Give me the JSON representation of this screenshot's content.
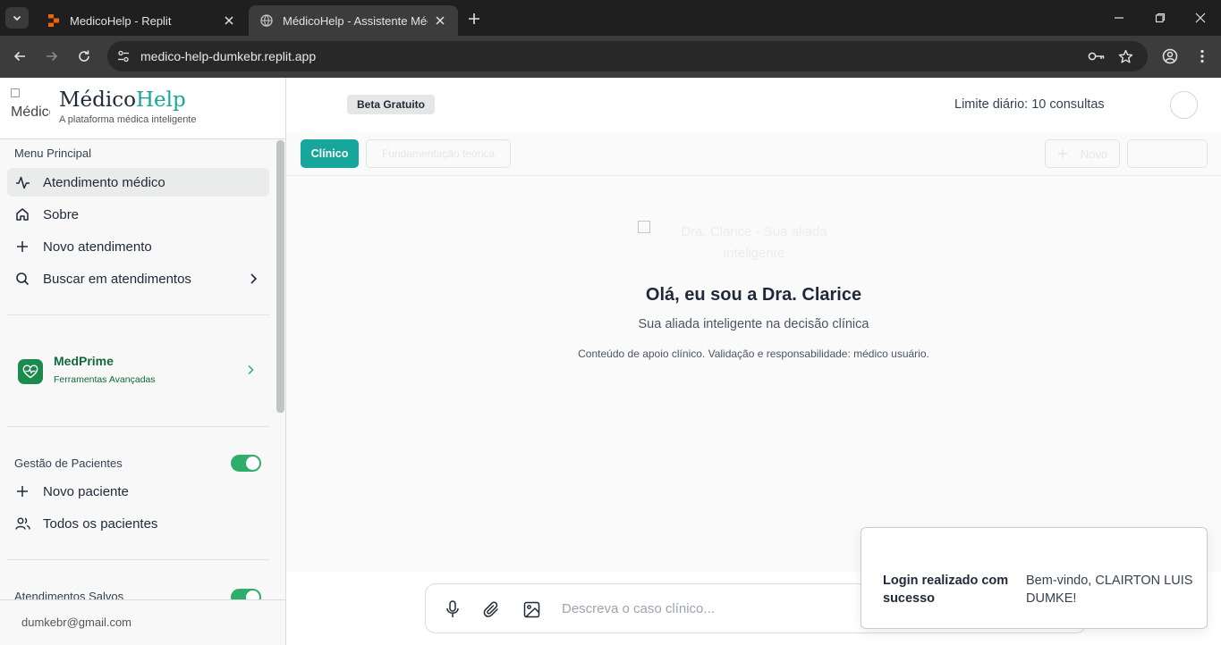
{
  "browser": {
    "tabs": [
      {
        "title": "MedicoHelp - Replit",
        "active": false
      },
      {
        "title": "MédicoHelp - Assistente Médico",
        "active": true
      }
    ],
    "url": "medico-help-dumkebr.replit.app"
  },
  "sidebar": {
    "logo_alt": "Médico",
    "brand_part1": "Médico",
    "brand_part2": "Help",
    "tagline": "A plataforma médica inteligente",
    "menu_label": "Menu Principal",
    "menu_items": [
      {
        "label": "Atendimento médico",
        "icon": "activity-icon",
        "active": true
      },
      {
        "label": "Sobre",
        "icon": "home-icon"
      },
      {
        "label": "Novo atendimento",
        "icon": "plus-icon"
      },
      {
        "label": "Buscar em atendimentos",
        "icon": "search-icon"
      }
    ],
    "medprime": {
      "title": "MedPrime",
      "subtitle": "Ferramentas Avançadas"
    },
    "patients": {
      "label": "Gestão de Pacientes",
      "toggle_on": true,
      "items": [
        {
          "label": "Novo paciente",
          "icon": "plus-icon"
        },
        {
          "label": "Todos os pacientes",
          "icon": "users-icon"
        }
      ]
    },
    "saved": {
      "label": "Atendimentos Salvos",
      "toggle_on": true
    },
    "user_email": "dumkebr@gmail.com"
  },
  "header": {
    "badge": "Beta Gratuito",
    "limit": "Limite diário: 10 consultas"
  },
  "modes": {
    "clinico": "Clínico",
    "fundamentacao": "Fundamentação teórica",
    "novo": "Novo"
  },
  "hero": {
    "image_alt": "Dra. Clarice - Sua aliada inteligente",
    "title": "Olá, eu sou a Dra. Clarice",
    "subtitle": "Sua aliada inteligente na decisão clínica",
    "disclaimer": "Conteúdo de apoio clínico. Validação e responsabilidade: médico usuário."
  },
  "composer": {
    "placeholder": "Descreva o caso clínico...",
    "value": ""
  },
  "toast": {
    "title": "Login realizado com sucesso",
    "message": "Bem-vindo, CLAIRTON LUIS DUMKE!"
  },
  "colors": {
    "accent": "#17a69b",
    "medprime": "#1a8a4d",
    "toggle": "#2fae6b"
  }
}
